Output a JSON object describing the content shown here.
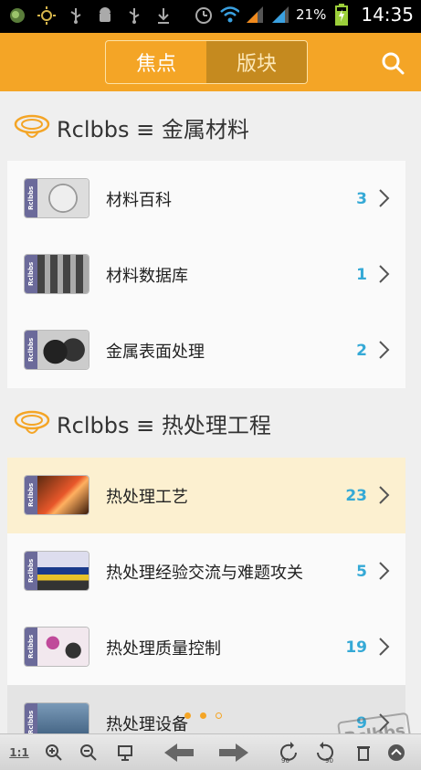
{
  "status_bar": {
    "battery_percent": "21%",
    "time": "14:35",
    "left_icons": [
      "app-icon",
      "sun-icon",
      "usb-icon",
      "android-debug-icon",
      "usb-icon",
      "download-icon"
    ],
    "right_icons": [
      "alarm-icon",
      "wifi-icon",
      "signal-icon",
      "signal-icon",
      "battery-icon"
    ]
  },
  "header": {
    "tabs": [
      {
        "label": "焦点",
        "active": false
      },
      {
        "label": "版块",
        "active": true
      }
    ],
    "search_icon": "search-icon"
  },
  "sections": [
    {
      "title": "Rclbbs ≡ 金属材料",
      "items": [
        {
          "label": "材料百科",
          "count": "3",
          "thumb_band": "Rclbbs",
          "highlight": false
        },
        {
          "label": "材料数据库",
          "count": "1",
          "thumb_band": "Rclbbs",
          "highlight": false
        },
        {
          "label": "金属表面处理",
          "count": "2",
          "thumb_band": "Rclbbs",
          "highlight": false
        }
      ]
    },
    {
      "title": "Rclbbs ≡ 热处理工程",
      "items": [
        {
          "label": "热处理工艺",
          "count": "23",
          "thumb_band": "Rclbbs",
          "highlight": true
        },
        {
          "label": "热处理经验交流与难题攻关",
          "count": "5",
          "thumb_band": "Rclbbs",
          "highlight": false
        },
        {
          "label": "热处理质量控制",
          "count": "19",
          "thumb_band": "Rclbbs",
          "highlight": false
        },
        {
          "label": "热处理设备",
          "count": "9",
          "thumb_band": "Rclbbs",
          "highlight": false
        }
      ]
    }
  ],
  "watermark": "Rclbbs",
  "toolbar": {
    "items": [
      "1:1",
      "zoom-in-icon",
      "zoom-out-icon",
      "fit-icon",
      "back-arrow-icon",
      "forward-arrow-icon",
      "rotate-left-icon",
      "rotate-right-icon",
      "delete-icon",
      "expand-icon"
    ],
    "rotate_left_label": "90",
    "rotate_right_label": "90",
    "scale_label": "1:1"
  },
  "colors": {
    "accent": "#f4a526",
    "active_tab": "#c58a1f",
    "count": "#35a9d6",
    "highlight_row": "#fcf0d0"
  }
}
